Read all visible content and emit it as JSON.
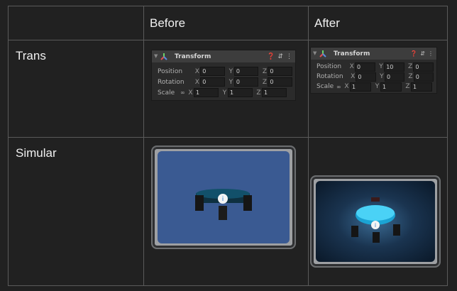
{
  "table": {
    "header_before": "Before",
    "header_after": "After",
    "row1_label": "Trans",
    "row2_label": "Simular"
  },
  "inspector_before": {
    "title": "Transform",
    "rows": [
      {
        "label": "Position",
        "x": "0",
        "y": "0",
        "z": "0"
      },
      {
        "label": "Rotation",
        "x": "0",
        "y": "0",
        "z": "0"
      },
      {
        "label": "Scale",
        "x": "1",
        "y": "1",
        "z": "1"
      }
    ]
  },
  "inspector_after": {
    "title": "Transform",
    "rows": [
      {
        "label": "Position",
        "x": "0",
        "y": "10",
        "z": "0"
      },
      {
        "label": "Rotation",
        "x": "0",
        "y": "0",
        "z": "0"
      },
      {
        "label": "Scale",
        "x": "1",
        "y": "1",
        "z": "1"
      }
    ]
  },
  "axis_labels": {
    "x": "X",
    "y": "Y",
    "z": "Z"
  },
  "icons": [
    "transform-axes-icon",
    "help-icon",
    "preset-icon",
    "more-icon",
    "scale-link-icon",
    "info-icon"
  ],
  "colors": {
    "background": "#212121",
    "border": "#5a5a5a",
    "before_screen": "#3a5a92",
    "after_screen": "#0e2236",
    "platform_glow": "#29c2ee"
  }
}
